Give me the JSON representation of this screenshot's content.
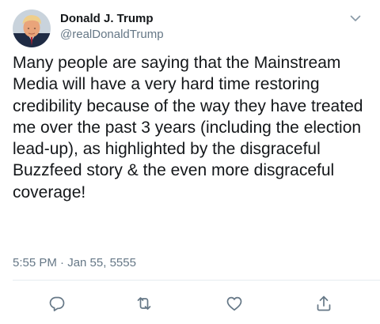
{
  "tweet": {
    "author": {
      "name": "Donald J. Trump",
      "handle": "@realDonaldTrump"
    },
    "text": "Many people are saying that the Mainstream Media will have a very hard time restoring credibility because of the way they have treated me over the past 3 years (including the election lead-up), as highlighted by the disgraceful Buzzfeed story & the even more disgraceful coverage!",
    "timestamp": "5:55 PM · Jan 55, 5555"
  },
  "icons": {
    "menu": "chevron-down-icon",
    "reply": "reply-icon",
    "retweet": "retweet-icon",
    "like": "heart-icon",
    "share": "share-icon"
  },
  "colors": {
    "text": "#14171a",
    "secondary": "#657786",
    "icon": "#657786",
    "divider": "#e6ecf0"
  }
}
